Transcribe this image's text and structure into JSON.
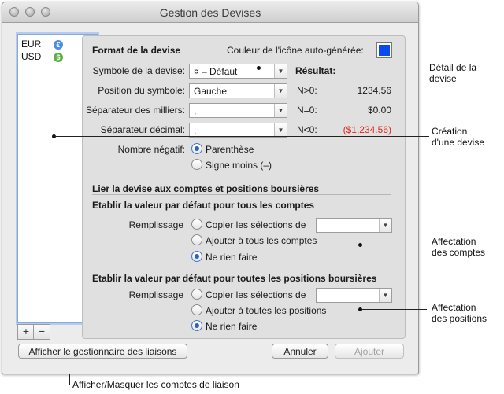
{
  "window": {
    "title": "Gestion des Devises"
  },
  "sidebar": {
    "items": [
      {
        "code": "EUR",
        "badge": "€",
        "badge_color": "#4a8ee0"
      },
      {
        "code": "USD",
        "badge": "$",
        "badge_color": "#5bb043"
      }
    ],
    "add_label": "+",
    "remove_label": "−"
  },
  "format": {
    "heading": "Format de la devise",
    "icon_color_label": "Couleur de l'icône auto-générée:",
    "icon_color": "#0a49f0",
    "symbol_label": "Symbole de la devise:",
    "symbol_value": "¤ – Défaut",
    "result_label": "Résultat:",
    "position_label": "Position du symbole:",
    "position_value": "Gauche",
    "thousands_label": "Séparateur des milliers:",
    "thousands_value": ",",
    "decimal_label": "Séparateur décimal:",
    "decimal_value": ".",
    "neg_label": "Nombre négatif:",
    "neg_options": [
      "Parenthèse",
      "Signe moins (–)"
    ],
    "results": [
      {
        "label": "N>0:",
        "value": "1234.56",
        "color": "#1a1a1a"
      },
      {
        "label": "N=0:",
        "value": "$0.00",
        "color": "#1a1a1a"
      },
      {
        "label": "N<0:",
        "value": "($1,234.56)",
        "color": "#e0281e"
      }
    ]
  },
  "link": {
    "heading": "Lier la devise aux comptes et positions boursières",
    "accounts_heading": "Etablir la valeur par défaut pour tous les comptes",
    "fill_label": "Remplissage",
    "accounts_options": [
      "Copier les sélections de",
      "Ajouter à tous les comptes",
      "Ne rien faire"
    ],
    "positions_heading": "Etablir la valeur par défaut pour toutes les positions boursières",
    "positions_options": [
      "Copier les sélections de",
      "Ajouter à toutes les positions",
      "Ne rien faire"
    ]
  },
  "footer": {
    "links_button": "Afficher le gestionnaire des liaisons",
    "cancel_button": "Annuler",
    "add_button": "Ajouter"
  },
  "annotations": {
    "detail": "Détail de la devise",
    "creation_1": "Création",
    "creation_2": "d'une devise",
    "accounts_1": "Affectation",
    "accounts_2": "des comptes",
    "positions_1": "Affectation",
    "positions_2": "des positions",
    "toggle": "Afficher/Masquer les comptes de liaison"
  }
}
